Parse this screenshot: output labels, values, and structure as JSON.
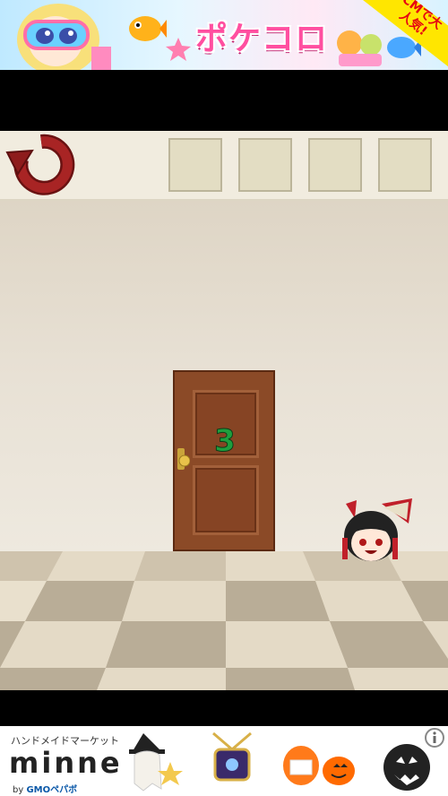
{
  "top_ad": {
    "logo_text": "ポケコロ",
    "corner_text": "CMで大人気!"
  },
  "toolbar": {
    "undo_icon": "circular-arrow-icon",
    "item_slots": [
      "",
      "",
      "",
      ""
    ]
  },
  "room": {
    "door_number": "3",
    "character": "shrine-maiden-head"
  },
  "bottom_ad": {
    "tagline": "ハンドメイドマーケット",
    "brand": "minne",
    "byline_prefix": "by ",
    "byline_brand": "GMOペパボ",
    "info_icon": "info-icon"
  },
  "colors": {
    "undo_red": "#8e1c1c",
    "door_brown": "#8b4a27",
    "number_green": "#1f9e3e",
    "wall": "#e4dccd",
    "floor_light": "#e9e0cd",
    "floor_dark": "#b9ad97"
  }
}
